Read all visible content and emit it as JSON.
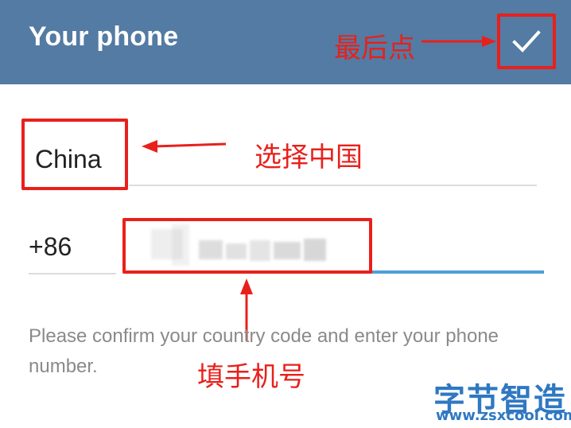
{
  "header": {
    "title": "Your phone",
    "done_icon": "checkmark-icon",
    "color": "#537ba3"
  },
  "form": {
    "country": "China",
    "country_code": "+86",
    "phone_value": "",
    "hint": "Please confirm your country code and enter your phone number."
  },
  "annotations": {
    "last_click": "最后点",
    "select_china": "选择中国",
    "fill_phone": "填手机号",
    "color": "#e8201c"
  },
  "watermark": {
    "name": "字节智造",
    "url": "www.zsxcool.com"
  }
}
